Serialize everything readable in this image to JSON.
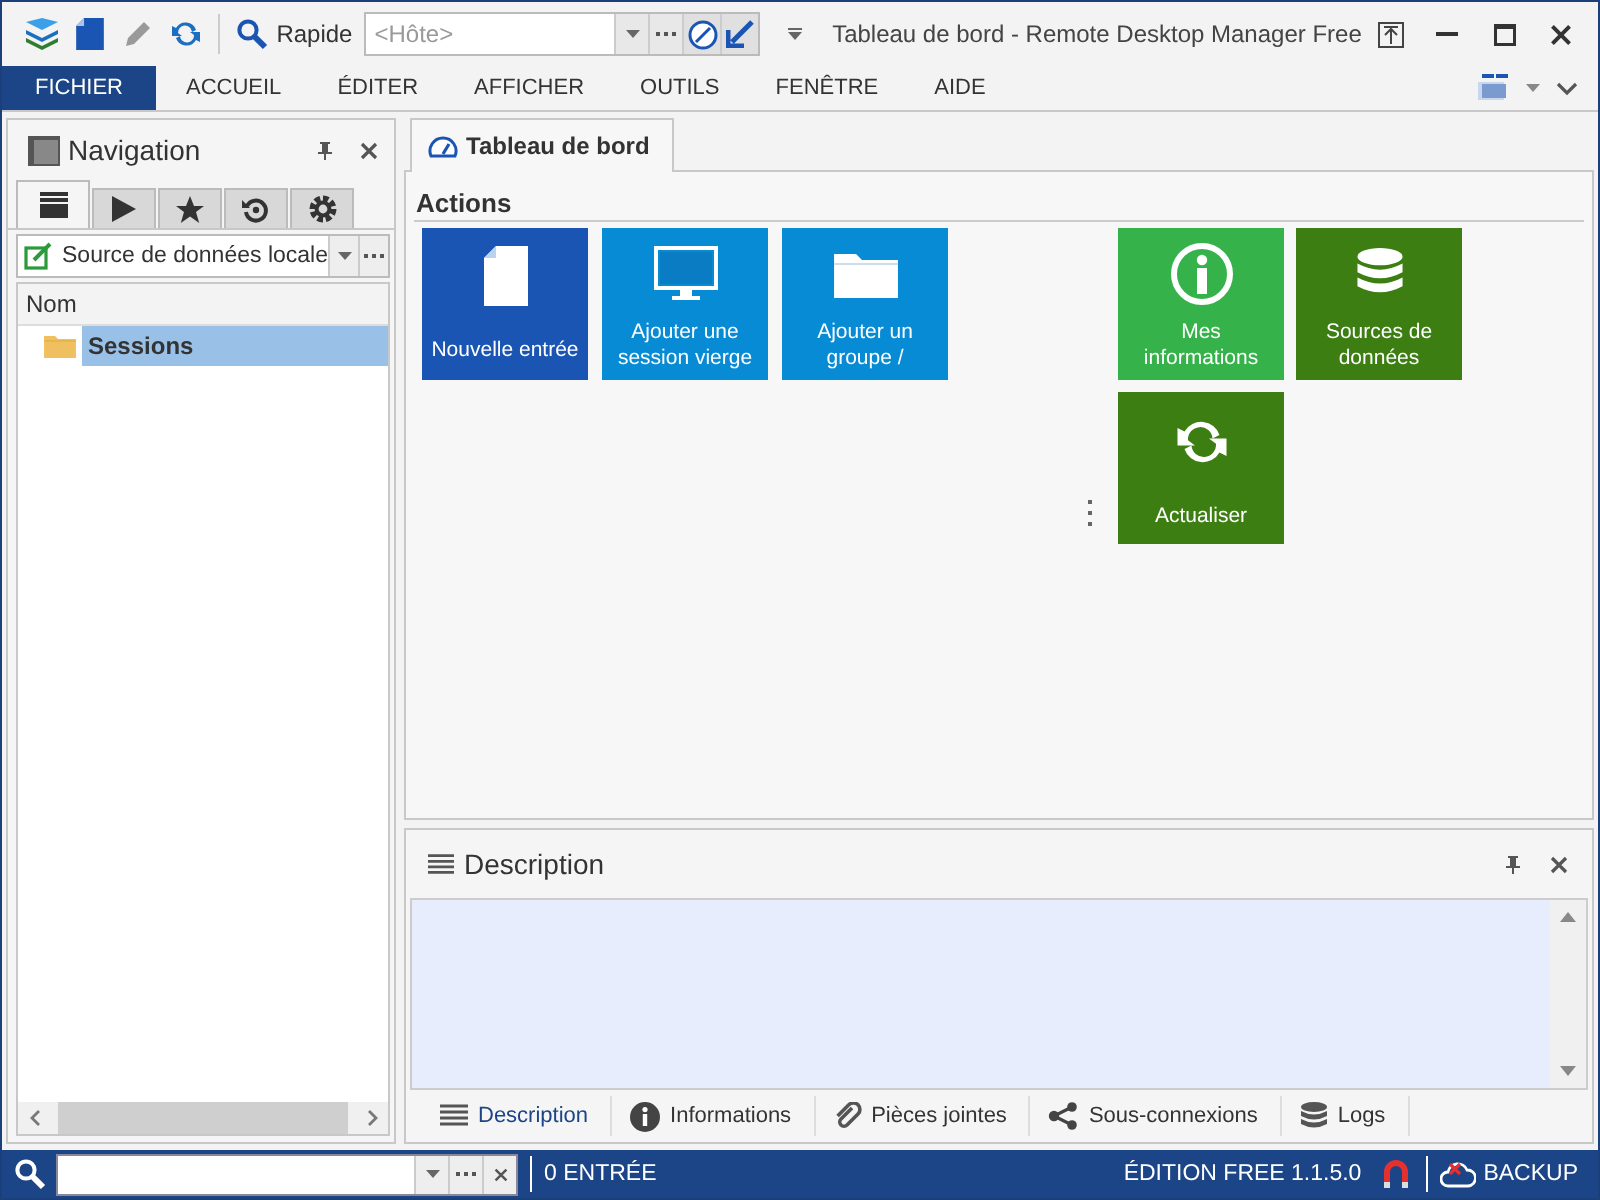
{
  "toolbar": {
    "quick_label": "Rapide",
    "host_field": {
      "placeholder": "<Hôte>"
    }
  },
  "window": {
    "title": "Tableau de bord - Remote Desktop Manager Free"
  },
  "menu": [
    {
      "label": "FICHIER",
      "selected": true
    },
    {
      "label": "ACCUEIL",
      "selected": false
    },
    {
      "label": "ÉDITER",
      "selected": false
    },
    {
      "label": "AFFICHER",
      "selected": false
    },
    {
      "label": "OUTILS",
      "selected": false
    },
    {
      "label": "FENÊTRE",
      "selected": false
    },
    {
      "label": "AIDE",
      "selected": false
    }
  ],
  "navigation": {
    "title": "Navigation",
    "tabs": [
      {
        "kind": "list",
        "selected": true
      },
      {
        "kind": "play",
        "selected": false
      },
      {
        "kind": "star",
        "selected": false
      },
      {
        "kind": "history",
        "selected": false
      },
      {
        "kind": "settings",
        "selected": false
      }
    ],
    "data_source": {
      "value": "Source de données locale"
    },
    "tree": {
      "column": "Nom",
      "items": [
        {
          "label": "Sessions",
          "selected": true
        }
      ]
    }
  },
  "document_tab": {
    "label": "Tableau de bord",
    "selected": true
  },
  "actions": {
    "title": "Actions",
    "groups": [
      {
        "tiles": [
          {
            "label": "Nouvelle entrée",
            "kind": "file",
            "color": "#1a55b3"
          },
          {
            "label": "Ajouter une session vierge",
            "kind": "monitor",
            "color": "#078bd4"
          },
          {
            "label": "Ajouter un groupe /",
            "kind": "folder",
            "color": "#078bd4"
          }
        ]
      },
      {
        "tiles": [
          {
            "label": "Mes informations",
            "kind": "info",
            "color": "#35b34a"
          },
          {
            "label": "Sources de données",
            "kind": "database",
            "color": "#3c7e12"
          },
          {
            "label": "Actualiser",
            "kind": "refresh",
            "color": "#3c7e12"
          }
        ]
      }
    ]
  },
  "description": {
    "title": "Description",
    "tabs": [
      {
        "label": "Description",
        "kind": "lines",
        "selected": true
      },
      {
        "label": "Informations",
        "kind": "info",
        "selected": false
      },
      {
        "label": "Pièces jointes",
        "kind": "clip",
        "selected": false
      },
      {
        "label": "Sous-connexions",
        "kind": "share",
        "selected": false
      },
      {
        "label": "Logs",
        "kind": "database",
        "selected": false
      }
    ]
  },
  "status_bar": {
    "entries": "0 ENTRÉE",
    "edition": "ÉDITION FREE 1.1.5.0",
    "backup": "BACKUP"
  }
}
